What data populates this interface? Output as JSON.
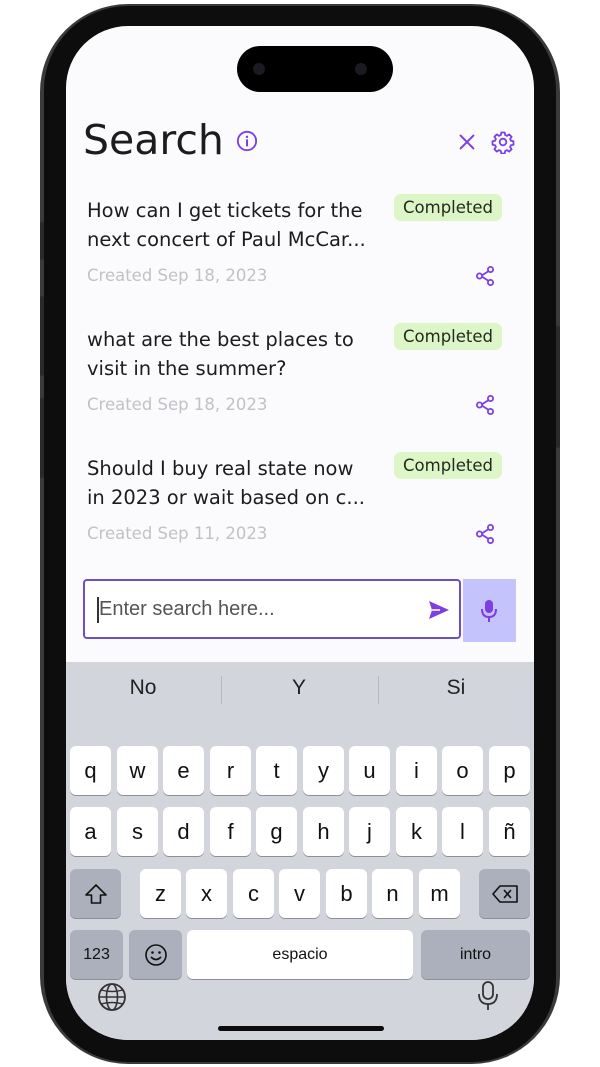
{
  "header": {
    "title": "Search",
    "info_icon": "info-icon",
    "close_icon": "close-icon",
    "settings_icon": "gear-icon"
  },
  "items": [
    {
      "line1": "How can I get tickets for the",
      "line2": "next concert of Paul McCar...",
      "status": "Completed",
      "created": "Created Sep 18, 2023"
    },
    {
      "line1": "what are the best places to",
      "line2": "visit in the summer?",
      "status": "Completed",
      "created": "Created Sep 18, 2023"
    },
    {
      "line1": "Should I buy real state now",
      "line2": "in 2023 or wait based on c...",
      "status": "Completed",
      "created": "Created Sep 11, 2023"
    }
  ],
  "search": {
    "placeholder": "Enter search here...",
    "value": ""
  },
  "keyboard": {
    "suggestions": [
      "No",
      "Y",
      "Si"
    ],
    "row1": [
      "q",
      "w",
      "e",
      "r",
      "t",
      "y",
      "u",
      "i",
      "o",
      "p"
    ],
    "row2": [
      "a",
      "s",
      "d",
      "f",
      "g",
      "h",
      "j",
      "k",
      "l",
      "ñ"
    ],
    "row3": [
      "z",
      "x",
      "c",
      "v",
      "b",
      "n",
      "m"
    ],
    "numbers_key": "123",
    "space_key": "espacio",
    "return_key": "intro"
  },
  "colors": {
    "accent": "#7b3fe4",
    "badge_bg": "#dcf6c8",
    "mic_button_bg": "#c4c3fb",
    "keyboard_bg": "#d3d5dc"
  }
}
